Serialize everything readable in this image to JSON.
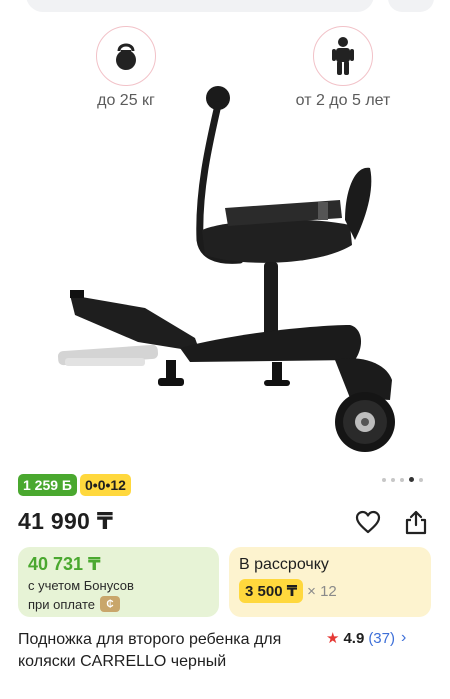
{
  "features": {
    "weight": {
      "icon": "kettlebell-icon",
      "label": "до 25 кг"
    },
    "age": {
      "icon": "child-icon",
      "label": "от 2 до 5 лет"
    }
  },
  "gallery": {
    "total_dots": 5,
    "active_index": 3
  },
  "badges": {
    "bonus": "1 259 Б",
    "installment": "0•0•12"
  },
  "price": "41 990 ₸",
  "bonus_card": {
    "amount": "40 731 ₸",
    "line1": "с учетом Бонусов",
    "line2": "при оплате"
  },
  "installment_card": {
    "title": "В рассрочку",
    "amount": "3 500 ₸",
    "multiplier": "× 12"
  },
  "product": {
    "title": "Подножка для второго ребенка для коляски CARRELLO черный",
    "rating": "4.9",
    "reviews": "(37)"
  },
  "colors": {
    "green": "#4aa82f",
    "yellow": "#ffd83d",
    "accent_pink": "#f2c2c8",
    "link_blue": "#3d6fd8",
    "star_red": "#e53935"
  }
}
